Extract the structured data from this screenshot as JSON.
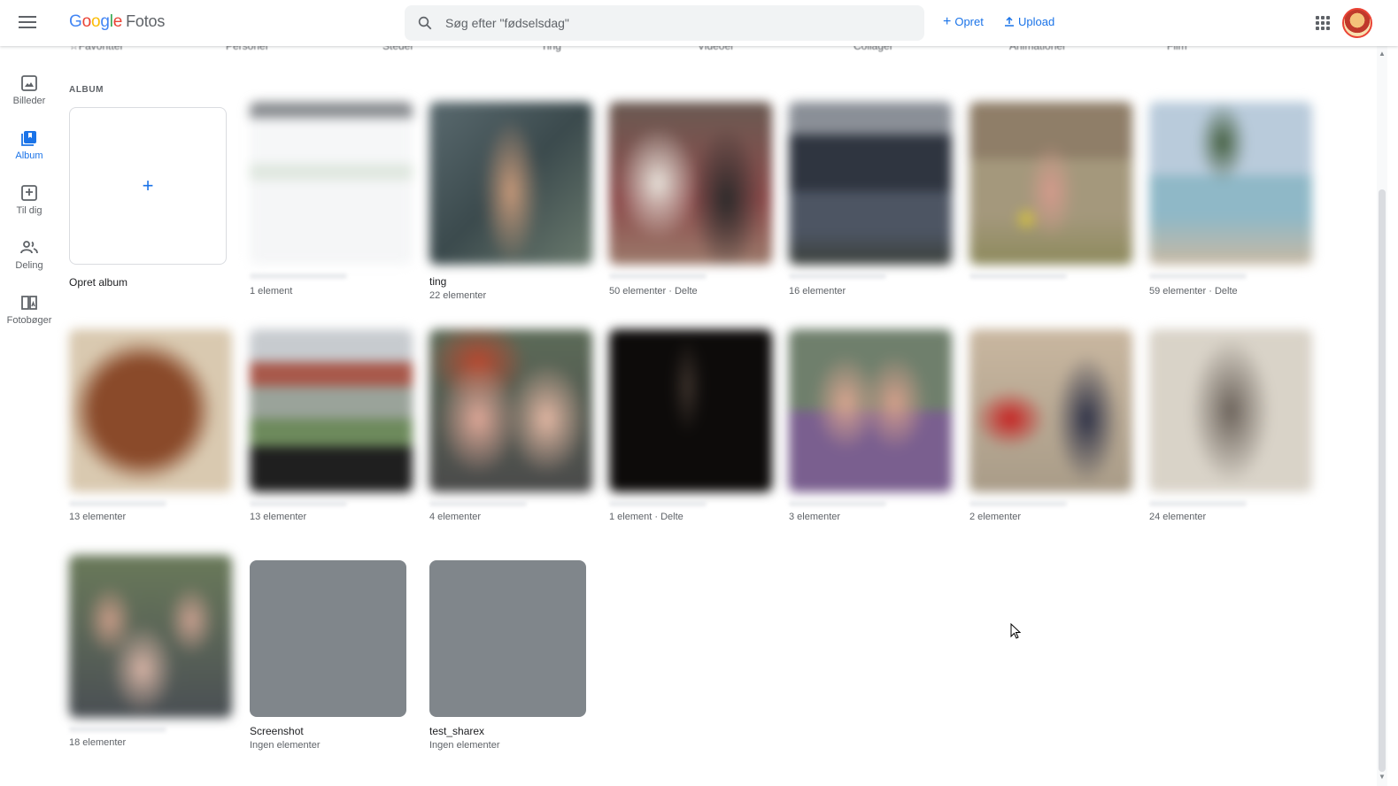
{
  "header": {
    "app_name_google": "Google",
    "app_name_product": "Fotos",
    "search_placeholder": "Søg efter \"fødselsdag\"",
    "create_label": "Opret",
    "upload_label": "Upload"
  },
  "categories": [
    "Favoritter",
    "Personer",
    "Steder",
    "Ting",
    "Videoer",
    "Collager",
    "Animationer",
    "Film"
  ],
  "sidebar": {
    "items": [
      {
        "label": "Billeder",
        "icon": "photo-icon"
      },
      {
        "label": "Album",
        "icon": "album-icon"
      },
      {
        "label": "Til dig",
        "icon": "for-you-icon"
      },
      {
        "label": "Deling",
        "icon": "sharing-icon"
      },
      {
        "label": "Fotobøger",
        "icon": "photobook-icon"
      }
    ]
  },
  "section": {
    "heading": "ALBUM",
    "create_album_label": "Opret album",
    "create_plus": "+"
  },
  "albums": [
    {
      "title": "",
      "sub": "1 element"
    },
    {
      "title": "ting",
      "sub": "22 elementer"
    },
    {
      "title": "",
      "sub": "50 elementer · Delte"
    },
    {
      "title": "",
      "sub": "16 elementer"
    },
    {
      "title": "",
      "sub": ""
    },
    {
      "title": "",
      "sub": "59 elementer · Delte"
    },
    {
      "title": "",
      "sub": "13 elementer"
    },
    {
      "title": "",
      "sub": "13 elementer"
    },
    {
      "title": "",
      "sub": "4 elementer"
    },
    {
      "title": "",
      "sub": "1 element · Delte"
    },
    {
      "title": "",
      "sub": "3 elementer"
    },
    {
      "title": "",
      "sub": "2 elementer"
    },
    {
      "title": "",
      "sub": "24 elementer"
    },
    {
      "title": "",
      "sub": "18 elementer"
    },
    {
      "title": "Screenshot",
      "sub": "Ingen elementer"
    },
    {
      "title": "test_sharex",
      "sub": "Ingen elementer"
    }
  ],
  "colors": {
    "accent": "#1a73e8",
    "empty_thumb": "#80868b"
  }
}
